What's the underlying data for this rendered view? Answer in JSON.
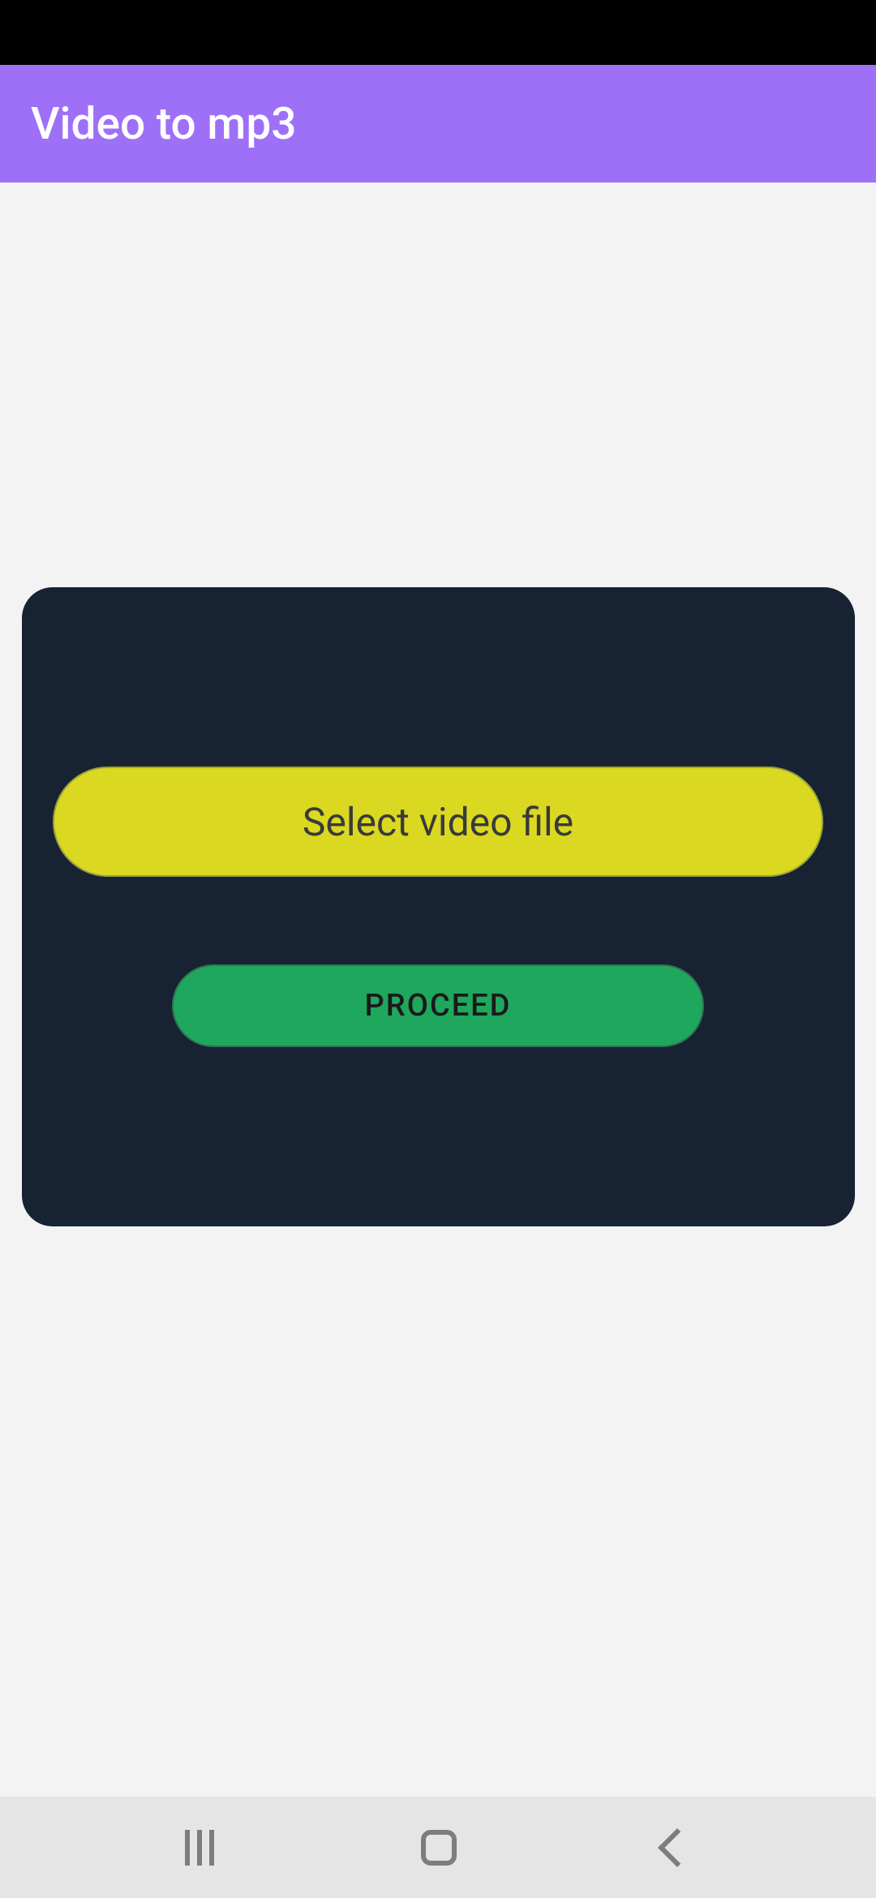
{
  "header": {
    "title": "Video to mp3"
  },
  "main": {
    "select_button_label": "Select video file",
    "proceed_button_label": "PROCEED"
  },
  "colors": {
    "app_bar": "#9d70f7",
    "card_bg": "#172233",
    "select_btn": "#dad821",
    "proceed_btn": "#1fa75e"
  }
}
